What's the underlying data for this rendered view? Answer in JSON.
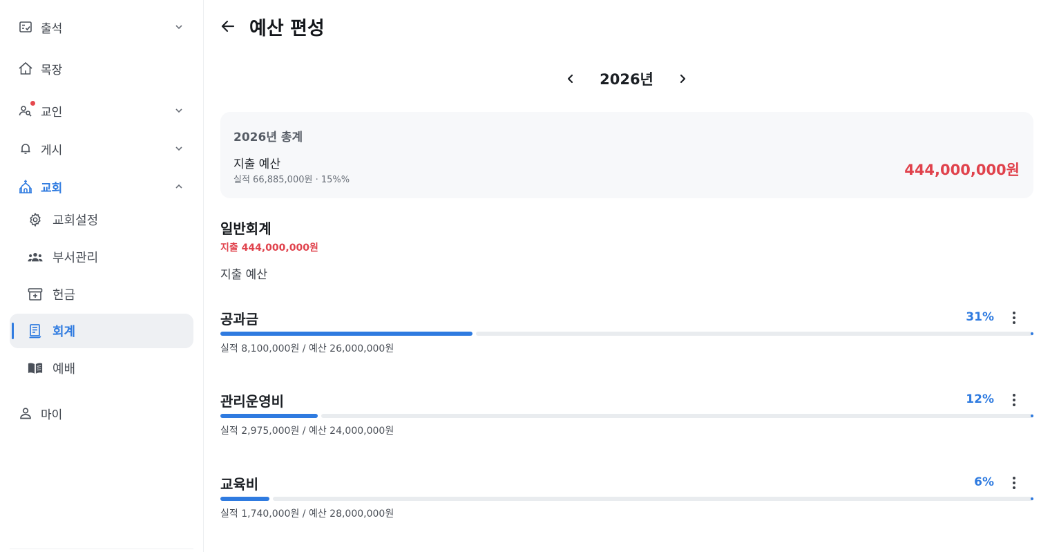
{
  "sidebar": {
    "items": [
      {
        "label": "출석",
        "icon": "attendance-icon"
      },
      {
        "label": "목장",
        "icon": "home-icon"
      },
      {
        "label": "교인",
        "icon": "member-search-icon"
      },
      {
        "label": "게시",
        "icon": "bell-icon"
      },
      {
        "label": "교회",
        "icon": "church-icon"
      },
      {
        "label": "교회설정",
        "icon": "gear-icon"
      },
      {
        "label": "부서관리",
        "icon": "group-icon"
      },
      {
        "label": "헌금",
        "icon": "offering-box-icon"
      },
      {
        "label": "회계",
        "icon": "ledger-icon"
      },
      {
        "label": "예배",
        "icon": "book-icon"
      },
      {
        "label": "마이",
        "icon": "person-icon"
      }
    ]
  },
  "header": {
    "title": "예산 편성"
  },
  "year_nav": {
    "label": "2026년"
  },
  "summary": {
    "title": "2026년 총계",
    "label": "지출 예산",
    "sub": "실적 66,885,000원 · 15%%",
    "amount": "444,000,000원"
  },
  "group": {
    "title": "일반회계",
    "total": "지출 444,000,000원",
    "section_label": "지출 예산",
    "items": [
      {
        "name": "공과금",
        "percent_label": "31%",
        "progress": 0.31,
        "detail": "실적 8,100,000원 / 예산 26,000,000원"
      },
      {
        "name": "관리운영비",
        "percent_label": "12%",
        "progress": 0.12,
        "detail": "실적 2,975,000원 / 예산 24,000,000원"
      },
      {
        "name": "교육비",
        "percent_label": "6%",
        "progress": 0.06,
        "detail": "실적 1,740,000원 / 예산 28,000,000원"
      }
    ]
  },
  "colors": {
    "accent": "#2f7be0",
    "negative": "#e0424c",
    "track": "#e9ecef",
    "selected_bg": "#eef0f3"
  }
}
